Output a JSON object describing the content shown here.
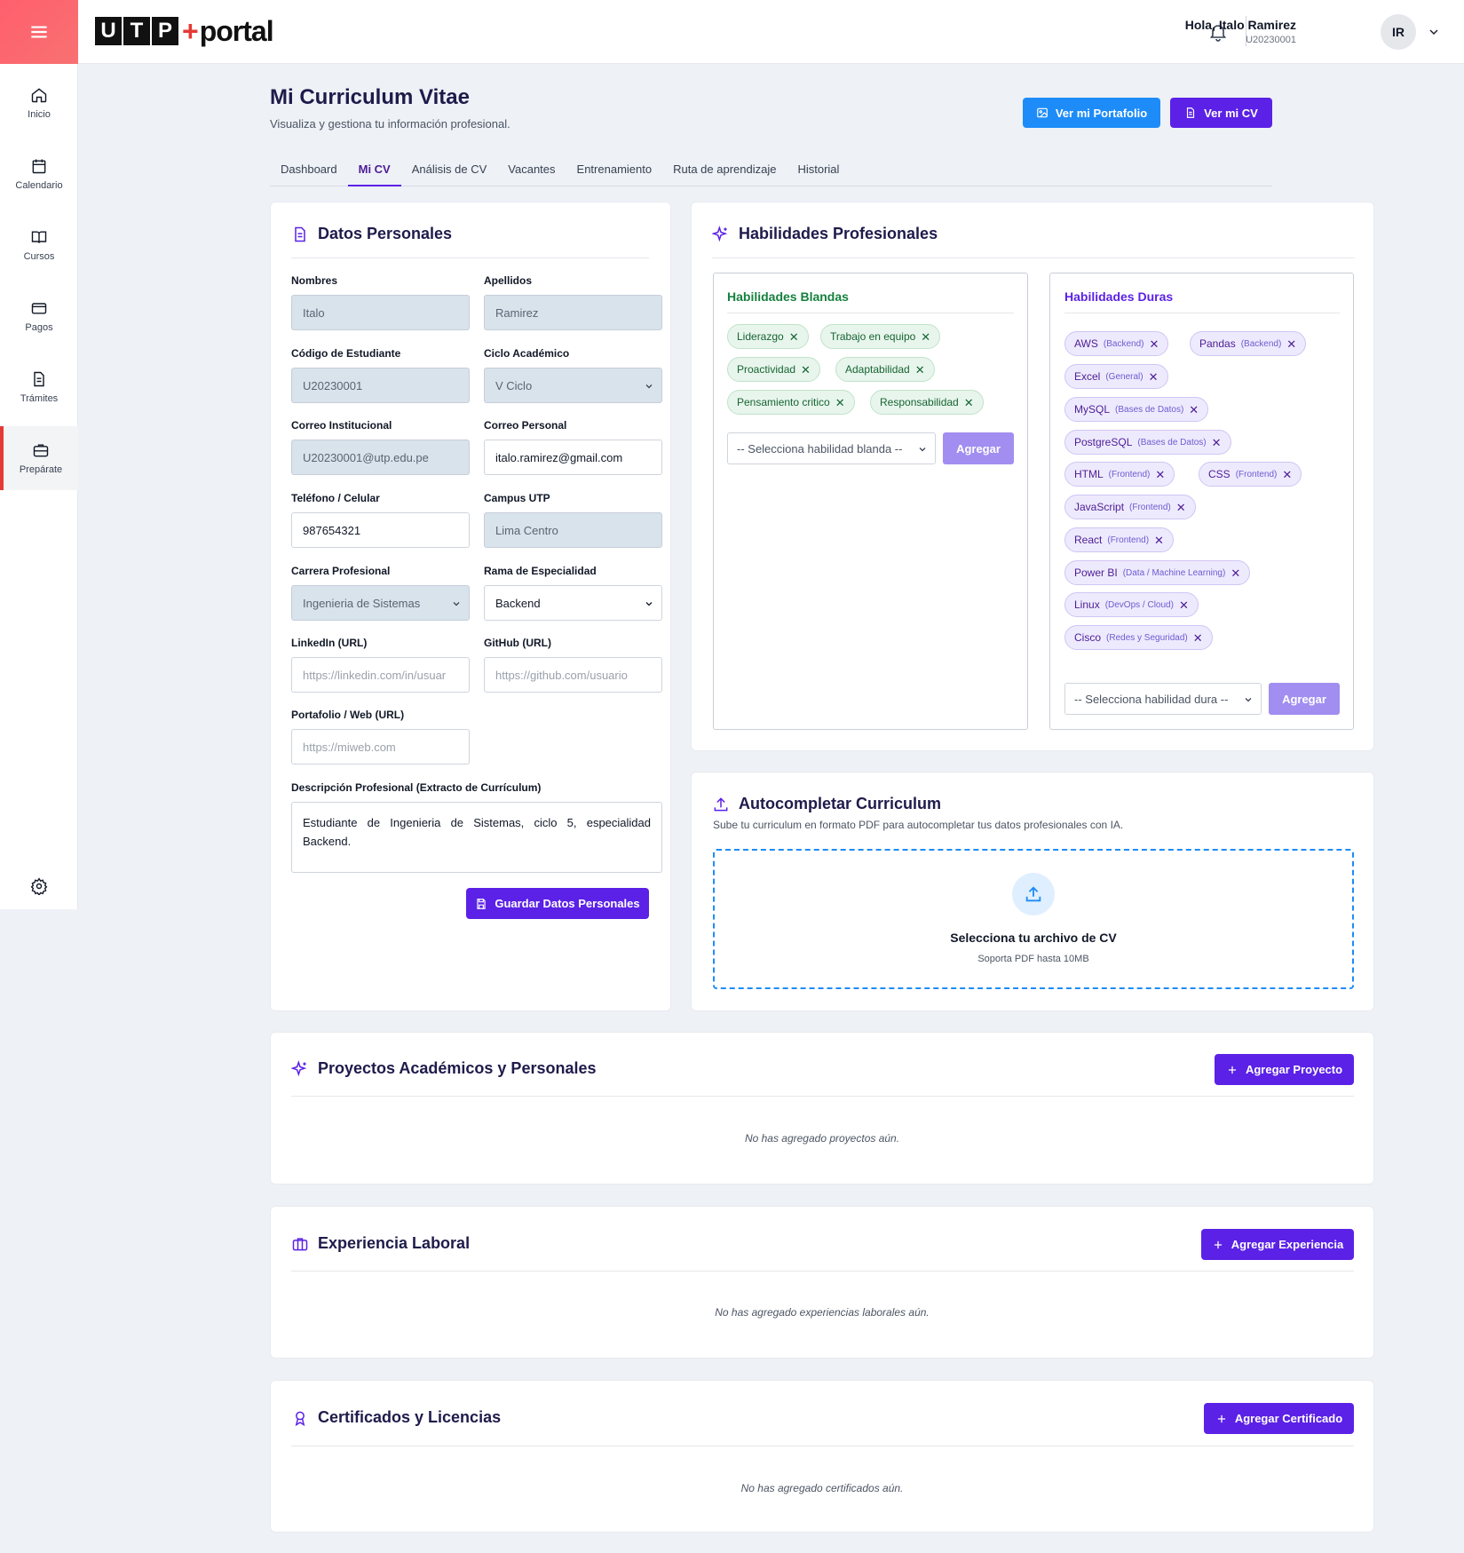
{
  "header": {
    "logo_letters": [
      "U",
      "T",
      "P"
    ],
    "logo_plus": "+",
    "logo_word": "portal",
    "greeting": "Hola, Italo Ramirez",
    "user_code": "U20230001",
    "avatar_initials": "IR"
  },
  "sidebar": {
    "items": [
      {
        "label": "Inicio",
        "icon": "home-icon"
      },
      {
        "label": "Calendario",
        "icon": "calendar-icon"
      },
      {
        "label": "Cursos",
        "icon": "book-icon"
      },
      {
        "label": "Pagos",
        "icon": "card-icon"
      },
      {
        "label": "Trámites",
        "icon": "document-icon"
      },
      {
        "label": "Prepárate",
        "icon": "briefcase-icon",
        "active": true
      }
    ]
  },
  "page": {
    "title": "Mi Curriculum Vitae",
    "subtitle": "Visualiza y gestiona tu información profesional.",
    "btn_portfolio": "Ver mi Portafolio",
    "btn_cv": "Ver mi CV"
  },
  "tabs": [
    "Dashboard",
    "Mi CV",
    "Análisis de CV",
    "Vacantes",
    "Entrenamiento",
    "Ruta de aprendizaje",
    "Historial"
  ],
  "active_tab": "Mi CV",
  "personal": {
    "title": "Datos Personales",
    "nombres_label": "Nombres",
    "nombres_value": "Italo",
    "apellidos_label": "Apellidos",
    "apellidos_value": "Ramirez",
    "codigo_label": "Código de Estudiante",
    "codigo_value": "U20230001",
    "ciclo_label": "Ciclo Académico",
    "ciclo_value": "V Ciclo",
    "correo_inst_label": "Correo Institucional",
    "correo_inst_value": "U20230001@utp.edu.pe",
    "correo_pers_label": "Correo Personal",
    "correo_pers_value": "italo.ramirez@gmail.com",
    "telefono_label": "Teléfono / Celular",
    "telefono_value": "987654321",
    "campus_label": "Campus UTP",
    "campus_value": "Lima Centro",
    "carrera_label": "Carrera Profesional",
    "carrera_value": "Ingenieria de Sistemas",
    "rama_label": "Rama de Especialidad",
    "rama_value": "Backend",
    "linkedin_label": "LinkedIn (URL)",
    "linkedin_placeholder": "https://linkedin.com/in/usuar",
    "github_label": "GitHub (URL)",
    "github_placeholder": "https://github.com/usuario",
    "portafolio_label": "Portafolio / Web (URL)",
    "portafolio_placeholder": "https://miweb.com",
    "descripcion_label": "Descripción Profesional (Extracto de Currículum)",
    "descripcion_value": "Estudiante de Ingenieria de Sistemas, ciclo 5, especialidad Backend.",
    "save_button": "Guardar Datos Personales"
  },
  "skills": {
    "title": "Habilidades Profesionales",
    "soft_title": "Habilidades Blandas",
    "soft": [
      "Liderazgo",
      "Trabajo en equipo",
      "Proactividad",
      "Adaptabilidad",
      "Pensamiento critico",
      "Responsabilidad"
    ],
    "soft_select": "-- Selecciona habilidad blanda --",
    "hard_title": "Habilidades Duras",
    "hard": [
      {
        "name": "AWS",
        "cat": "(Backend)"
      },
      {
        "name": "Pandas",
        "cat": "(Backend)"
      },
      {
        "name": "Excel",
        "cat": "(General)"
      },
      {
        "name": "MySQL",
        "cat": "(Bases de Datos)"
      },
      {
        "name": "PostgreSQL",
        "cat": "(Bases de Datos)"
      },
      {
        "name": "HTML",
        "cat": "(Frontend)"
      },
      {
        "name": "CSS",
        "cat": "(Frontend)"
      },
      {
        "name": "JavaScript",
        "cat": "(Frontend)"
      },
      {
        "name": "React",
        "cat": "(Frontend)"
      },
      {
        "name": "Power BI",
        "cat": "(Data / Machine Learning)"
      },
      {
        "name": "Linux",
        "cat": "(DevOps / Cloud)"
      },
      {
        "name": "Cisco",
        "cat": "(Redes y Seguridad)"
      }
    ],
    "hard_select": "-- Selecciona habilidad dura --",
    "add_label": "Agregar",
    "remove_glyph": "✕"
  },
  "autocomplete": {
    "title": "Autocompletar Curriculum",
    "subtitle": "Sube tu curriculum en formato PDF para autocompletar tus datos profesionales con IA.",
    "drop_title": "Selecciona tu archivo de CV",
    "drop_sub": "Soporta PDF hasta 10MB"
  },
  "projects": {
    "title": "Proyectos Académicos y Personales",
    "button": "Agregar Proyecto",
    "empty": "No has agregado proyectos aún."
  },
  "experience": {
    "title": "Experiencia Laboral",
    "button": "Agregar Experiencia",
    "empty": "No has agregado experiencias laborales aún."
  },
  "certificates": {
    "title": "Certificados y Licencias",
    "button": "Agregar Certificado",
    "empty": "No has agregado certificados aún."
  },
  "colors": {
    "accent": "#5b21e6",
    "blue": "#1d8cf8",
    "brand_red": "#e53935",
    "soft_chip": "#e8f5ec",
    "hard_chip": "#eeeafd"
  }
}
